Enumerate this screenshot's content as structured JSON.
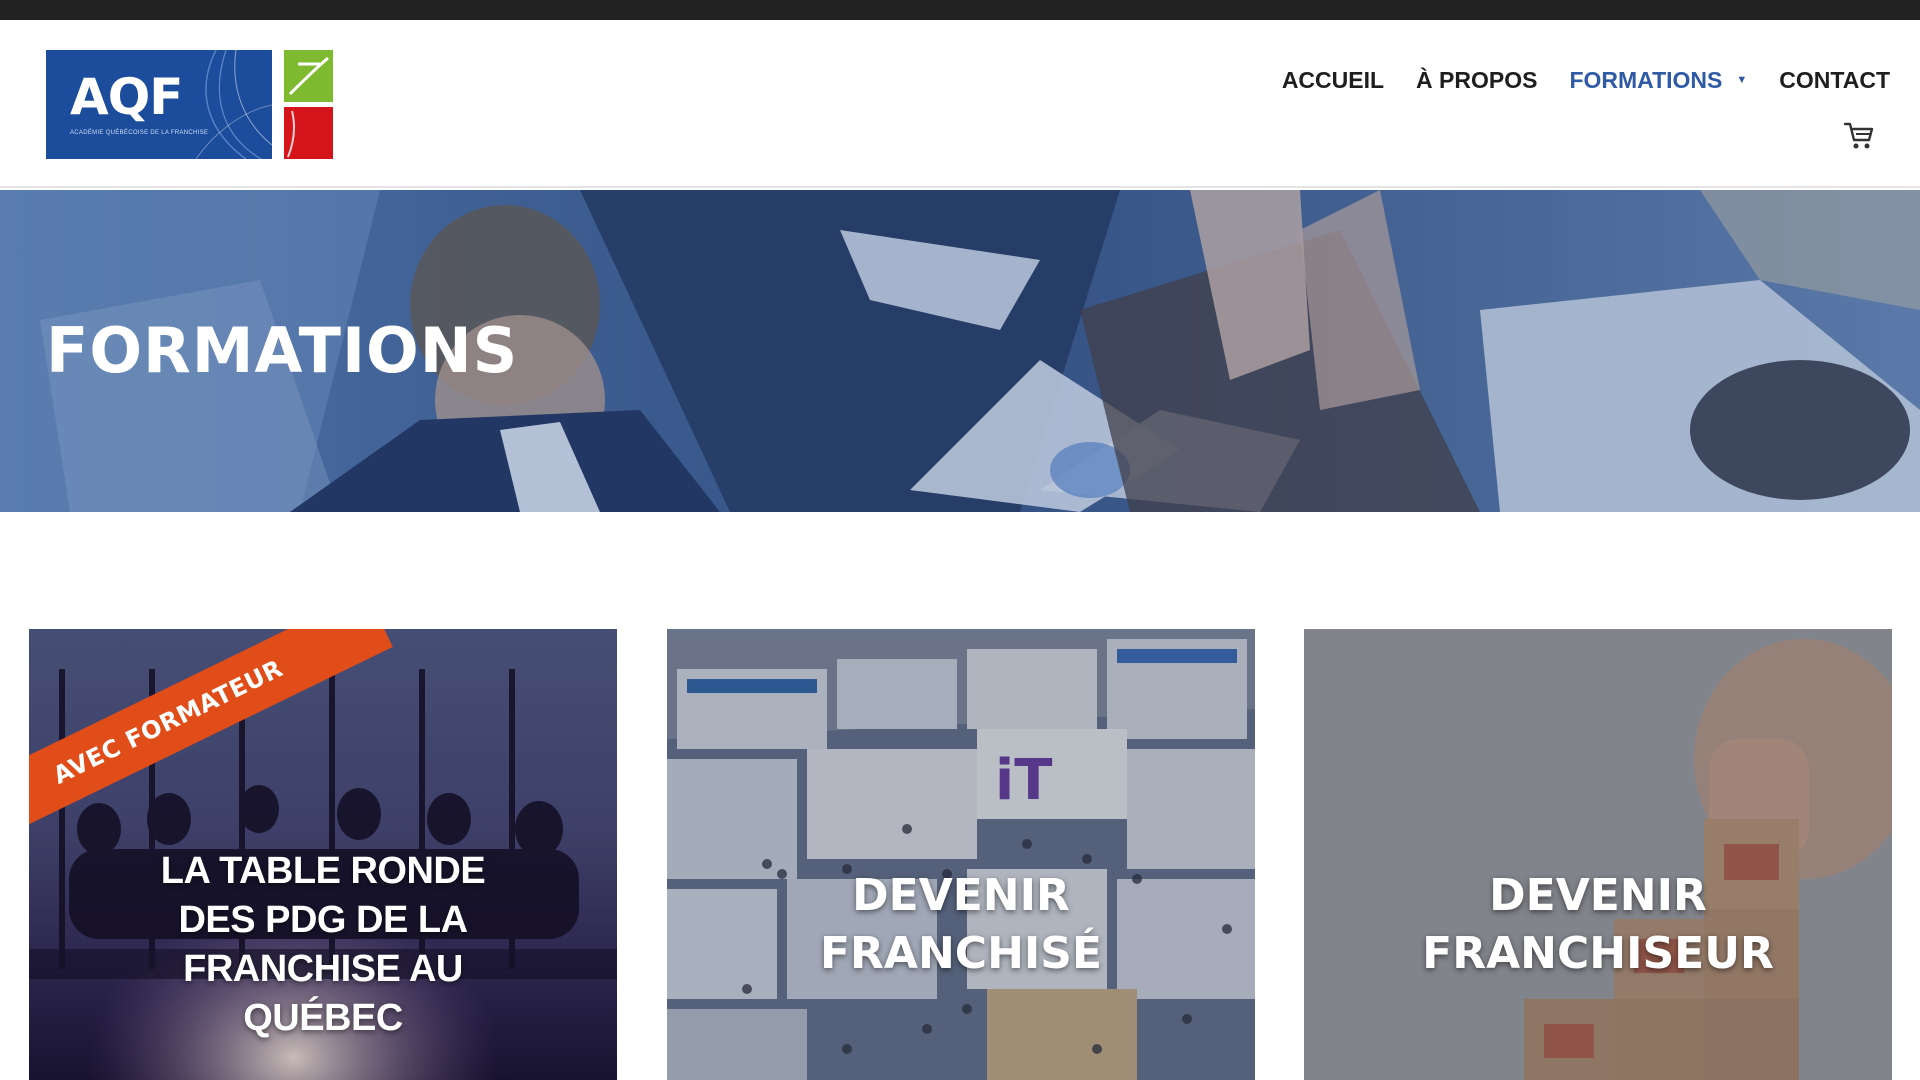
{
  "logo": {
    "text": "AQF",
    "tagline": "ACADÉMIE QUÉBÉCOISE DE LA FRANCHISE"
  },
  "nav": {
    "items": [
      {
        "label": "ACCUEIL"
      },
      {
        "label": "À PROPOS"
      },
      {
        "label": "FORMATIONS",
        "active": true
      },
      {
        "label": "CONTACT"
      }
    ]
  },
  "hero": {
    "title": "FORMATIONS"
  },
  "cards": [
    {
      "ribbon": "AVEC FORMATEUR",
      "title": "LA TABLE RONDE DES PDG DE LA FRANCHISE AU QUÉBEC"
    },
    {
      "title": "DEVENIR FRANCHISÉ"
    },
    {
      "title": "DEVENIR FRANCHISEUR"
    }
  ],
  "colors": {
    "accent": "#2f5aa5",
    "logo_blue": "#1c4d9c",
    "logo_green": "#7dba2f",
    "logo_red": "#d6141c",
    "ribbon": "#e14d19",
    "topbar": "#222222"
  },
  "icons": [
    "cart-icon",
    "chevron-down-icon"
  ]
}
